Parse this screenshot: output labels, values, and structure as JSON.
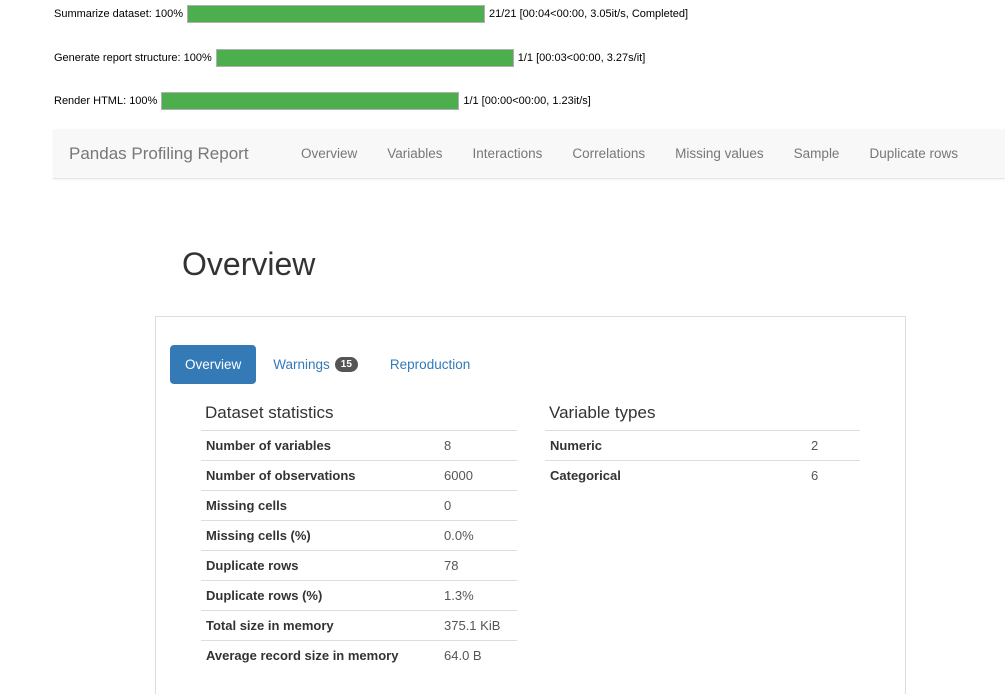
{
  "progress": [
    {
      "label": "Summarize dataset: 100%",
      "fraction": 1.0,
      "stats": "21/21 [00:04<00:00, 3.05it/s, Completed]"
    },
    {
      "label": "Generate report structure: 100%",
      "fraction": 1.0,
      "stats": "1/1 [00:03<00:00, 3.27s/it]"
    },
    {
      "label": "Render HTML: 100%",
      "fraction": 1.0,
      "stats": "1/1 [00:00<00:00, 1.23it/s]"
    }
  ],
  "navbar": {
    "brand": "Pandas Profiling Report",
    "links": [
      "Overview",
      "Variables",
      "Interactions",
      "Correlations",
      "Missing values",
      "Sample",
      "Duplicate rows"
    ]
  },
  "page": {
    "title": "Overview"
  },
  "tabs": {
    "overview": "Overview",
    "warnings": "Warnings",
    "warnings_count": "15",
    "reproduction": "Reproduction"
  },
  "dataset_statistics": {
    "title": "Dataset statistics",
    "rows": [
      {
        "key": "Number of variables",
        "value": "8"
      },
      {
        "key": "Number of observations",
        "value": "6000"
      },
      {
        "key": "Missing cells",
        "value": "0"
      },
      {
        "key": "Missing cells (%)",
        "value": "0.0%"
      },
      {
        "key": "Duplicate rows",
        "value": "78"
      },
      {
        "key": "Duplicate rows (%)",
        "value": "1.3%"
      },
      {
        "key": "Total size in memory",
        "value": "375.1 KiB"
      },
      {
        "key": "Average record size in memory",
        "value": "64.0 B"
      }
    ]
  },
  "variable_types": {
    "title": "Variable types",
    "rows": [
      {
        "key": "Numeric",
        "value": "2"
      },
      {
        "key": "Categorical",
        "value": "6"
      }
    ]
  },
  "colors": {
    "progress_fill": "#4cae4c",
    "tab_active": "#337ab7",
    "badge": "#555555"
  }
}
